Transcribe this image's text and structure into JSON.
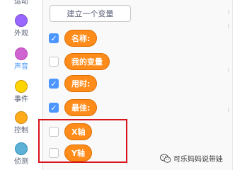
{
  "categories": [
    {
      "key": "motion",
      "label": "运动",
      "color": "#4c97ff",
      "active": false
    },
    {
      "key": "looks",
      "label": "外观",
      "color": "#9966ff",
      "active": false
    },
    {
      "key": "sound",
      "label": "声音",
      "color": "#cf63cf",
      "active": true
    },
    {
      "key": "events",
      "label": "事件",
      "color": "#ffbf00",
      "active": false
    },
    {
      "key": "control",
      "label": "控制",
      "color": "#ffab19",
      "active": false
    },
    {
      "key": "sensing",
      "label": "侦测",
      "color": "#5cb1d6",
      "active": false
    }
  ],
  "palette": {
    "make_variable_label": "建立一个变量",
    "variables": [
      {
        "label": "名称:",
        "checked": true
      },
      {
        "label": "我的变量",
        "checked": false
      },
      {
        "label": "用时:",
        "checked": true
      },
      {
        "label": "最佳:",
        "checked": true
      },
      {
        "label": "X轴",
        "checked": false
      },
      {
        "label": "Y轴",
        "checked": false
      }
    ]
  },
  "colors": {
    "variable_block": "#ff8c1a",
    "checkbox_checked": "#4c97ff",
    "highlight": "#d7141a"
  },
  "watermark": {
    "text": "可乐妈妈说带娃",
    "icon": "wechat-icon"
  }
}
